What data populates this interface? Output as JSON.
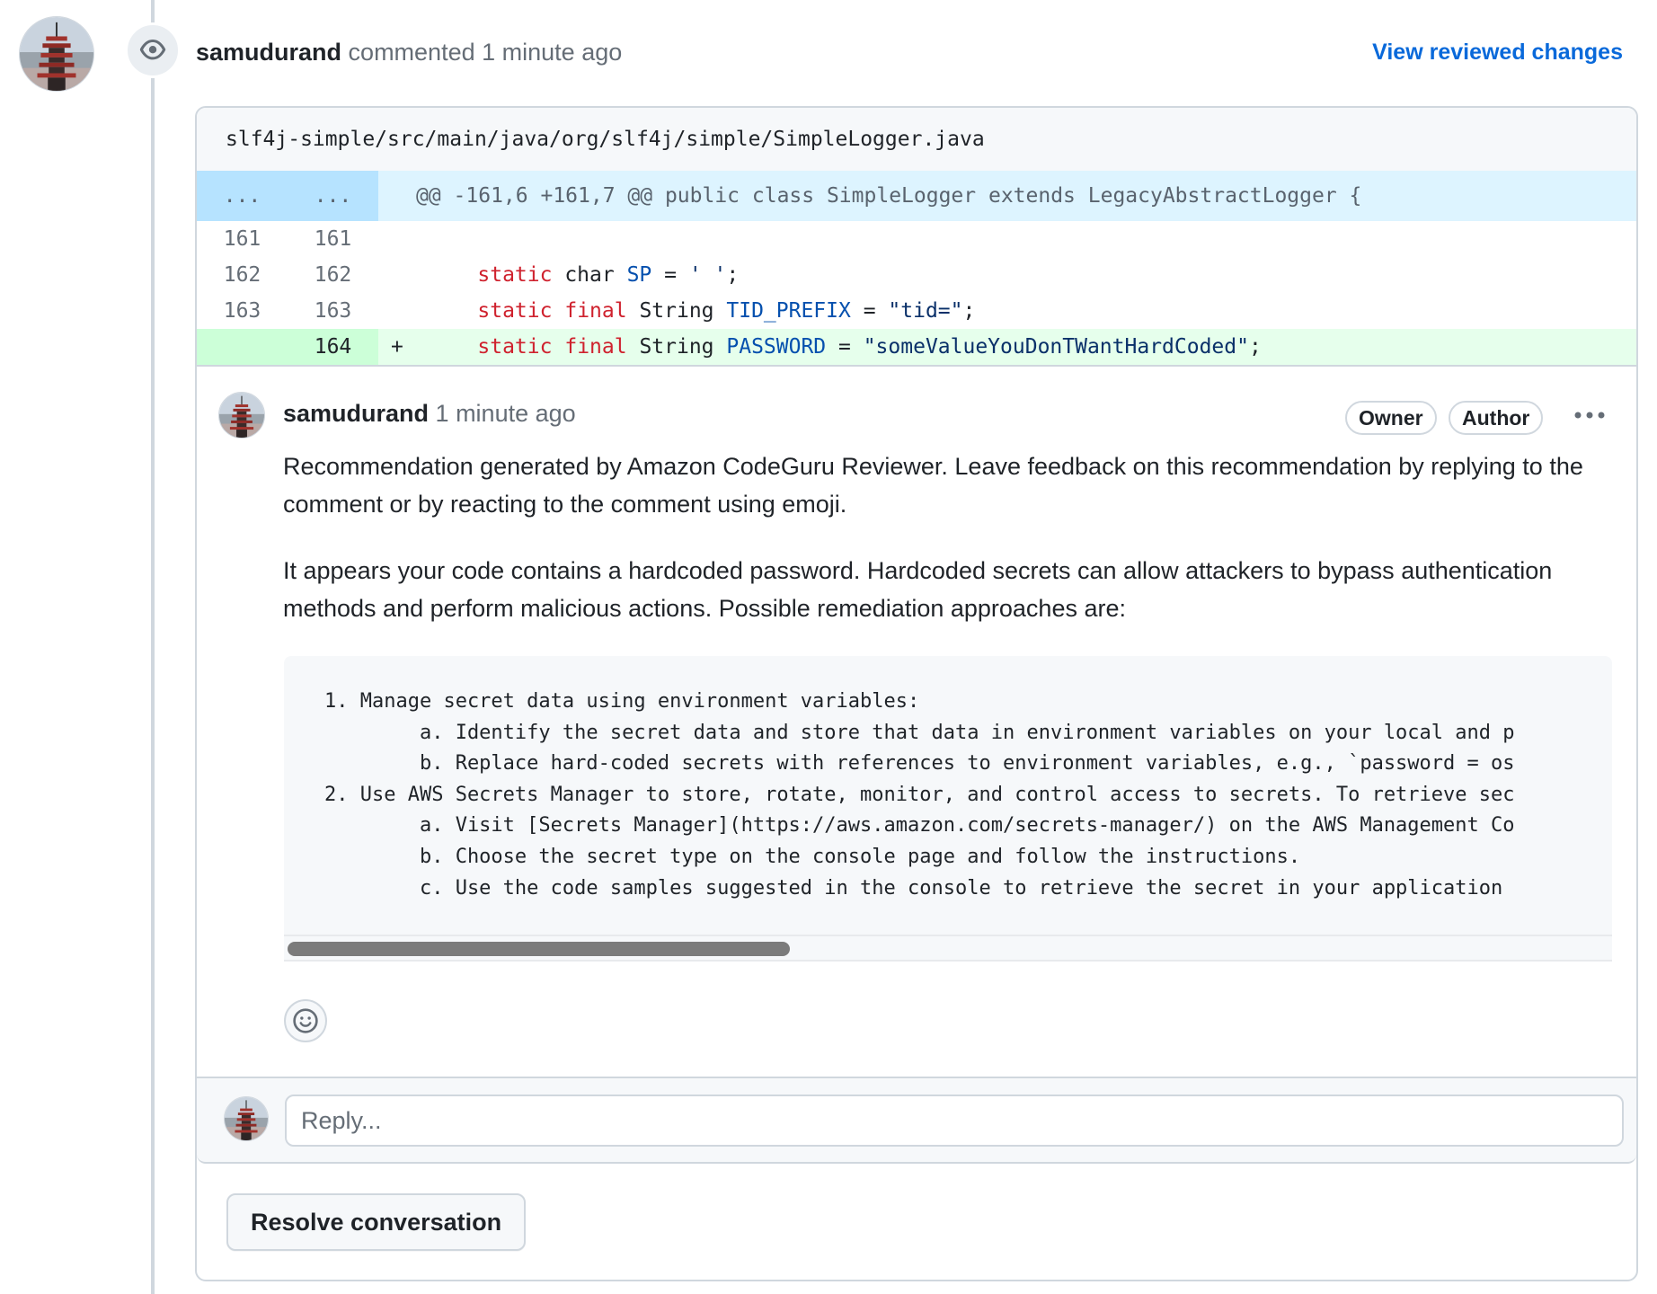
{
  "timeline_event": {
    "author": "samudurand",
    "action": "commented",
    "time": "1 minute ago",
    "view_link": "View reviewed changes",
    "badge_icon": "eye-icon"
  },
  "diff": {
    "file_path": "slf4j-simple/src/main/java/org/slf4j/simple/SimpleLogger.java",
    "hunk": {
      "old_marker": "...",
      "new_marker": "...",
      "header": "@@ -161,6 +161,7 @@ public class SimpleLogger extends LegacyAbstractLogger {"
    },
    "rows": [
      {
        "old": "161",
        "new": "161",
        "marker": "",
        "type": "context",
        "tokens": []
      },
      {
        "old": "162",
        "new": "162",
        "marker": "",
        "type": "context",
        "tokens": [
          {
            "t": "    ",
            "c": "ty"
          },
          {
            "t": "static",
            "c": "kw"
          },
          {
            "t": " char ",
            "c": "ty"
          },
          {
            "t": "SP",
            "c": "id"
          },
          {
            "t": " = ",
            "c": "ty"
          },
          {
            "t": "' '",
            "c": "str"
          },
          {
            "t": ";",
            "c": "ty"
          }
        ]
      },
      {
        "old": "163",
        "new": "163",
        "marker": "",
        "type": "context",
        "tokens": [
          {
            "t": "    ",
            "c": "ty"
          },
          {
            "t": "static",
            "c": "kw"
          },
          {
            "t": " ",
            "c": "ty"
          },
          {
            "t": "final",
            "c": "kw"
          },
          {
            "t": " String ",
            "c": "ty"
          },
          {
            "t": "TID_PREFIX",
            "c": "id"
          },
          {
            "t": " = ",
            "c": "ty"
          },
          {
            "t": "\"tid=\"",
            "c": "str"
          },
          {
            "t": ";",
            "c": "ty"
          }
        ]
      },
      {
        "old": "",
        "new": "164",
        "marker": "+",
        "type": "addition",
        "tokens": [
          {
            "t": "    ",
            "c": "ty"
          },
          {
            "t": "static",
            "c": "kw"
          },
          {
            "t": " ",
            "c": "ty"
          },
          {
            "t": "final",
            "c": "kw"
          },
          {
            "t": " String ",
            "c": "ty"
          },
          {
            "t": "PASSWORD",
            "c": "id"
          },
          {
            "t": " = ",
            "c": "ty"
          },
          {
            "t": "\"someValueYouDonTWantHardCoded\"",
            "c": "str"
          },
          {
            "t": ";",
            "c": "ty"
          }
        ]
      }
    ]
  },
  "comment": {
    "author": "samudurand",
    "time": "1 minute ago",
    "labels": [
      "Owner",
      "Author"
    ],
    "more_icon": "kebab-horizontal-icon",
    "paragraph1": "Recommendation generated by Amazon CodeGuru Reviewer. Leave feedback on this recommendation by replying to the comment or by reacting to the comment using emoji.",
    "paragraph2": "It appears your code contains a hardcoded password. Hardcoded secrets can allow attackers to bypass authentication methods and perform malicious actions. Possible remediation approaches are:",
    "code_block": "1. Manage secret data using environment variables:\n        a. Identify the secret data and store that data in environment variables on your local and p\n        b. Replace hard-coded secrets with references to environment variables, e.g., `password = os\n2. Use AWS Secrets Manager to store, rotate, monitor, and control access to secrets. To retrieve sec\n        a. Visit [Secrets Manager](https://aws.amazon.com/secrets-manager/) on the AWS Management Co\n        b. Choose the secret type on the console page and follow the instructions.\n        c. Use the code samples suggested in the console to retrieve the secret in your application",
    "scroll_position": 0.0,
    "scroll_visible_fraction": 0.38,
    "reaction_icon": "smiley-icon"
  },
  "reply": {
    "placeholder": "Reply...",
    "value": ""
  },
  "resolve_button": "Resolve conversation",
  "colors": {
    "link": "#0969da",
    "keyword": "#cf222e",
    "identifier": "#0550ae",
    "string": "#0a3069",
    "addition_bg": "#e6ffec",
    "addition_gutter": "#ccffd8",
    "hunk_bg": "#ddf4ff",
    "hunk_gutter": "#b6e3ff"
  }
}
